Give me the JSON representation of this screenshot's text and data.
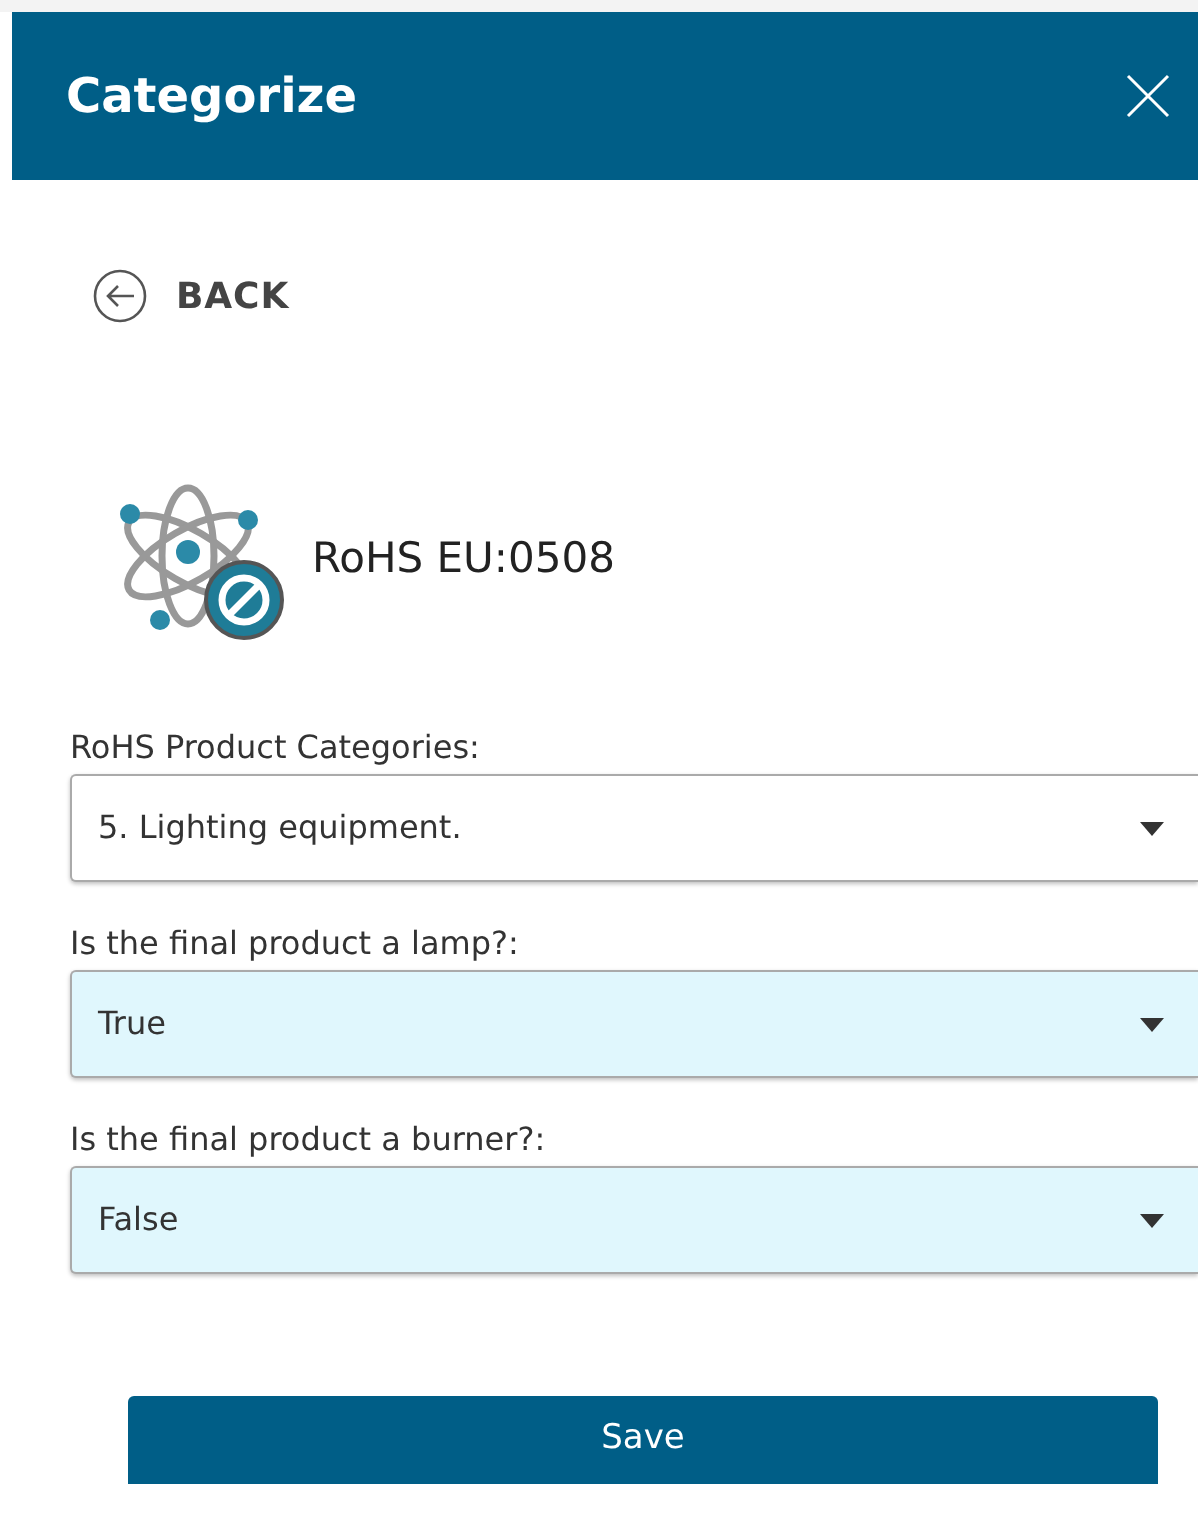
{
  "header": {
    "title": "Categorize"
  },
  "back": {
    "label": "BACK"
  },
  "regulation": {
    "name": "RoHS EU:0508"
  },
  "fields": [
    {
      "label": "RoHS Product Categories:",
      "value": "5. Lighting equipment.",
      "highlighted": false
    },
    {
      "label": "Is the final product a lamp?:",
      "value": "True",
      "highlighted": true
    },
    {
      "label": "Is the final product a burner?:",
      "value": "False",
      "highlighted": true
    }
  ],
  "buttons": [
    {
      "label": "Save"
    }
  ]
}
